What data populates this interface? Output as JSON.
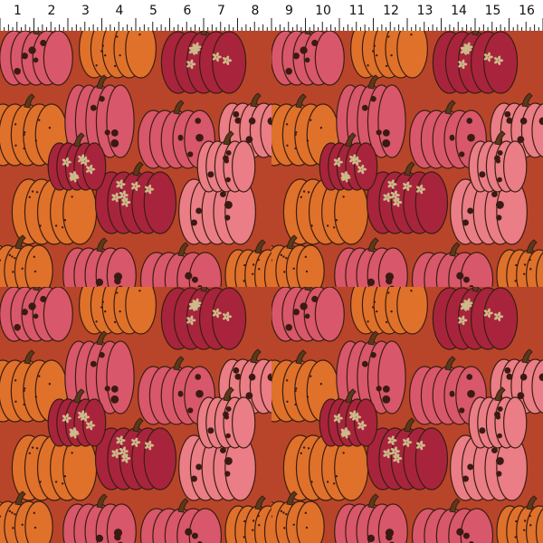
{
  "ruler": {
    "labels": [
      "1",
      "2",
      "3",
      "4",
      "5",
      "6",
      "7",
      "8",
      "9",
      "10",
      "11",
      "12",
      "13",
      "14",
      "15",
      "16"
    ]
  },
  "fabric": {
    "pattern": "tossed pumpkins print",
    "colors": {
      "background": "#b8452a",
      "orange": "#e0712a",
      "orange_dark": "#b8521c",
      "pink": "#d9576a",
      "pink_light": "#ea7d86",
      "magenta": "#a8243c",
      "dot": "#3b1a14",
      "flower": "#cdb98a",
      "outline": "#3a1d10"
    }
  }
}
